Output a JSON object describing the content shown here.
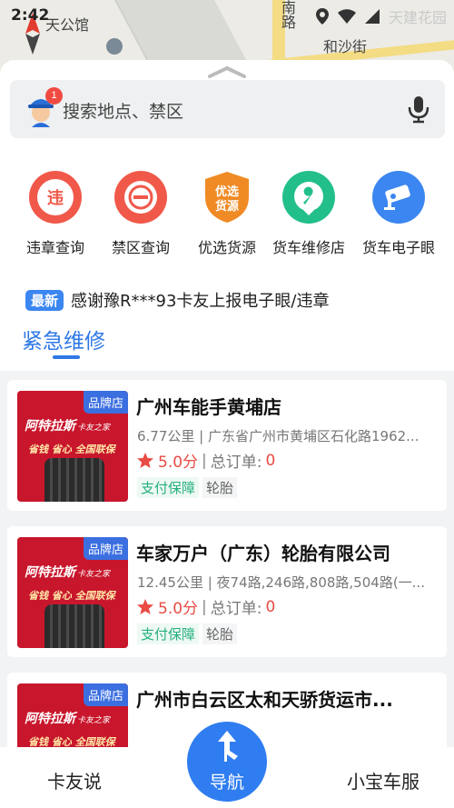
{
  "status_bar": {
    "time": "2:42",
    "ghost_text": "天建花园"
  },
  "map": {
    "labels": [
      "天公馆",
      "南路",
      "和沙街"
    ]
  },
  "search": {
    "placeholder": "搜索地点、禁区",
    "badge_count": "1"
  },
  "features": [
    {
      "label": "违章查询",
      "icon": "violation-icon",
      "glyph": "违",
      "color": "#f0594a"
    },
    {
      "label": "禁区查询",
      "icon": "no-entry-icon",
      "glyph": "",
      "color": "#f0594a"
    },
    {
      "label": "优选货源",
      "icon": "cargo-shield-icon",
      "glyph": "优选货源",
      "color": "#f08a24"
    },
    {
      "label": "货车维修店",
      "icon": "wrench-icon",
      "glyph": "",
      "color": "#22bf8a"
    },
    {
      "label": "货车电子眼",
      "icon": "camera-icon",
      "glyph": "",
      "color": "#3b86f0"
    }
  ],
  "news": {
    "tag": "最新",
    "text": "感谢豫R***93卡友上报电子眼/违章"
  },
  "section": {
    "title": "紧急维修"
  },
  "shops": [
    {
      "pin": "品牌店",
      "brand": "阿特拉斯",
      "brand_sub": "卡友之家",
      "slogan": "省钱 省心 全国联保",
      "name": "广州车能手黄埔店",
      "address": "6.77公里 | 广东省广州市黄埔区石化路1962...",
      "score": "5.0分",
      "orders_label": "总订单:",
      "orders": "0",
      "tags": [
        "支付保障",
        "轮胎"
      ]
    },
    {
      "pin": "品牌店",
      "brand": "阿特拉斯",
      "brand_sub": "卡友之家",
      "slogan": "省钱 省心 全国联保",
      "name": "车家万户（广东）轮胎有限公司",
      "address": "12.45公里 | 夜74路,246路,808路,504路(一...",
      "score": "5.0分",
      "orders_label": "总订单:",
      "orders": "0",
      "tags": [
        "支付保障",
        "轮胎"
      ]
    },
    {
      "pin": "品牌店",
      "brand": "阿特拉斯",
      "brand_sub": "卡友之家",
      "slogan": "省钱 省心 全国联保",
      "name": "广州市白云区太和天骄货运市...",
      "address": "",
      "score": "",
      "orders_label": "",
      "orders": "",
      "tags": []
    }
  ],
  "bottom_nav": {
    "left": "卡友说",
    "center": "导航",
    "right": "小宝车服"
  },
  "colors": {
    "accent": "#2f7df0",
    "danger": "#e84b44",
    "green": "#24b07c"
  }
}
